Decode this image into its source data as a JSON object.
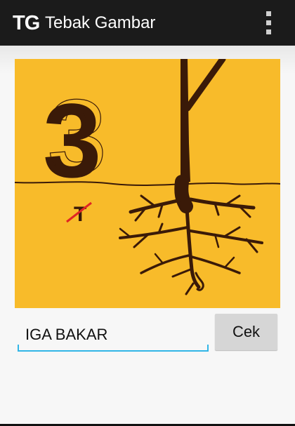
{
  "action_bar": {
    "logo_text": "TG",
    "title": "Tebak Gambar",
    "overflow_icon": "overflow-menu-icon"
  },
  "puzzle": {
    "digit": "3",
    "struck_letter": "T",
    "image_description_icon": "tree-with-roots",
    "colors": {
      "background": "#f8bb2a",
      "ink": "#3a1a08",
      "strike": "#e02424"
    }
  },
  "answer": {
    "value": "IGA BAKAR",
    "placeholder": ""
  },
  "check_button": {
    "label": "Cek"
  },
  "colors": {
    "accent": "#31b6e7",
    "action_bar": "#1b1b1b"
  }
}
